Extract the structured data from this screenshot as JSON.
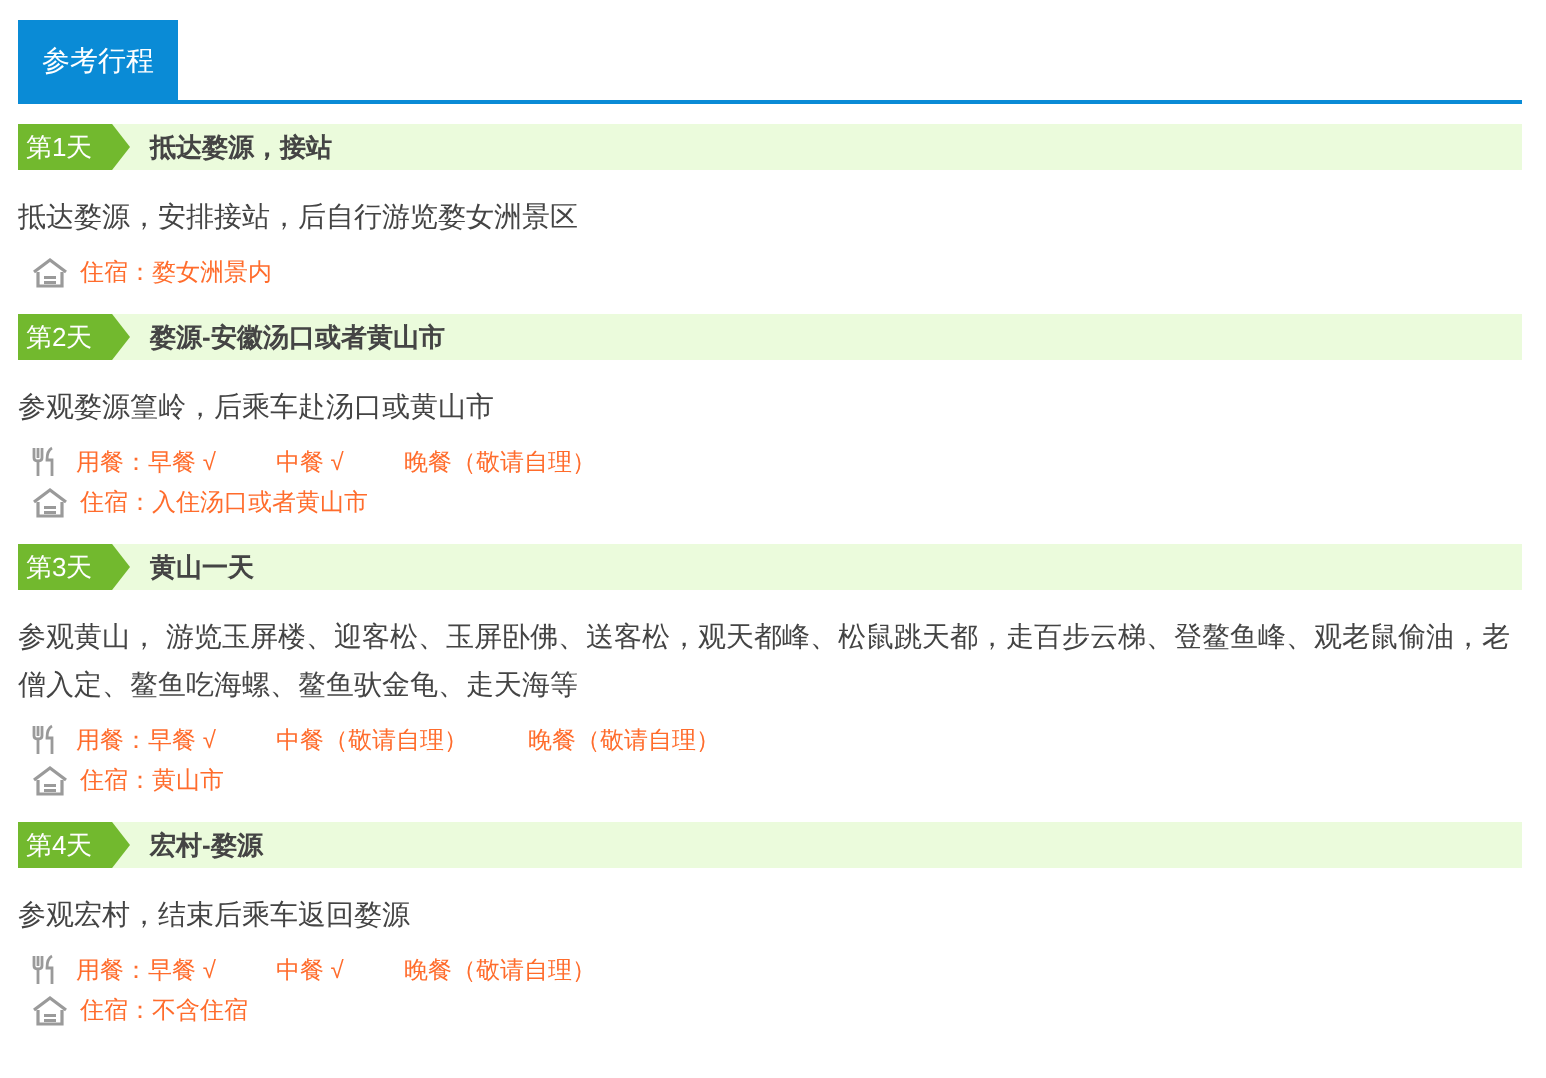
{
  "tabs": [
    {
      "label": "参考行程",
      "selected": true
    }
  ],
  "days": [
    {
      "badge": "第1天",
      "title": "抵达婺源，接站",
      "description": "抵达婺源，安排接站，后自行游览婺女洲景区",
      "lodging": "住宿：婺女洲景内"
    },
    {
      "badge": "第2天",
      "title": "婺源-安徽汤口或者黄山市",
      "description": "参观婺源篁岭，后乘车赴汤口或黄山市",
      "meals": [
        "用餐：早餐 √",
        "中餐 √",
        "晚餐（敬请自理）"
      ],
      "lodging": "住宿：入住汤口或者黄山市"
    },
    {
      "badge": "第3天",
      "title": "黄山一天",
      "description": "参观黄山， 游览玉屏楼、迎客松、玉屏卧佛、送客松，观天都峰、松鼠跳天都，走百步云梯、登鳌鱼峰、观老鼠偷油，老僧入定、鳌鱼吃海螺、鳌鱼驮金龟、走天海等",
      "meals": [
        "用餐：早餐 √",
        "中餐（敬请自理）",
        "晚餐（敬请自理）"
      ],
      "lodging": "住宿：黄山市"
    },
    {
      "badge": "第4天",
      "title": "宏村-婺源",
      "description": "参观宏村，结束后乘车返回婺源",
      "meals": [
        "用餐：早餐 √",
        "中餐 √",
        "晚餐（敬请自理）"
      ],
      "lodging": "住宿：不含住宿"
    }
  ]
}
